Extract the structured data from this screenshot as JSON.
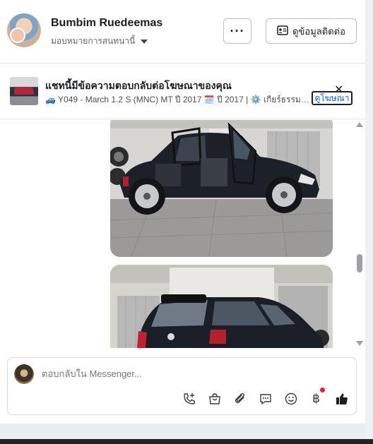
{
  "header": {
    "name": "Bumbim Ruedeemas",
    "assign_label": "มอบหมายการสนทนานี้",
    "more_label": "···",
    "contact_label": "ดูข้อมูลติดต่อ"
  },
  "ad": {
    "title": "แชทนี้มีข้อความตอบกลับต่อโฆษณาของคุณ",
    "subtitle": "🚙 Y049 - March 1.2 S (MNC) MT ปี 2017 🗓️ ปี 2017 | ⚙️ เกียร์ธรรมดา",
    "close_label": "✕",
    "view_label": "ดูโฆษณา"
  },
  "composer": {
    "placeholder": "ตอบกลับใน Messenger..."
  },
  "toolbar": {
    "icons": [
      "phone-plus-icon",
      "shopping-bag-icon",
      "paperclip-icon",
      "quick-reply-icon",
      "emoji-icon",
      "baht-icon",
      "thumbs-up-icon"
    ],
    "baht_symbol": "฿"
  },
  "colors": {
    "accent": "#0064d1",
    "like": "#1c1e21",
    "badge": "#e41e3f"
  }
}
